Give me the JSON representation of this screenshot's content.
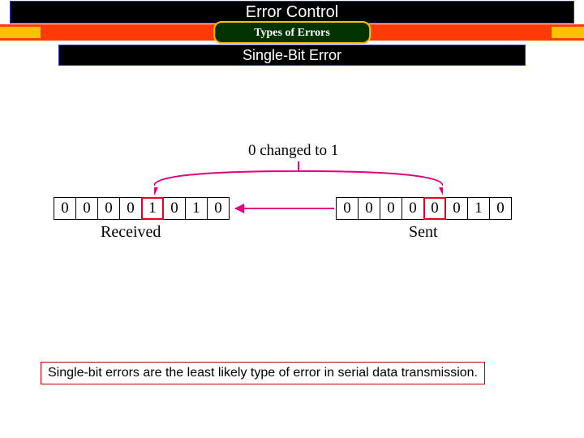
{
  "title": "Error Control",
  "subtitle": "Types of Errors",
  "section": "Single-Bit Error",
  "diagram": {
    "change_label": "0 changed to 1",
    "received_bits": [
      "0",
      "0",
      "0",
      "0",
      "1",
      "0",
      "1",
      "0"
    ],
    "received_highlight_index": 4,
    "received_label": "Received",
    "sent_bits": [
      "0",
      "0",
      "0",
      "0",
      "0",
      "0",
      "1",
      "0"
    ],
    "sent_highlight_index": 4,
    "sent_label": "Sent"
  },
  "footer": "Single-bit errors are the least likely type of error in serial data transmission."
}
